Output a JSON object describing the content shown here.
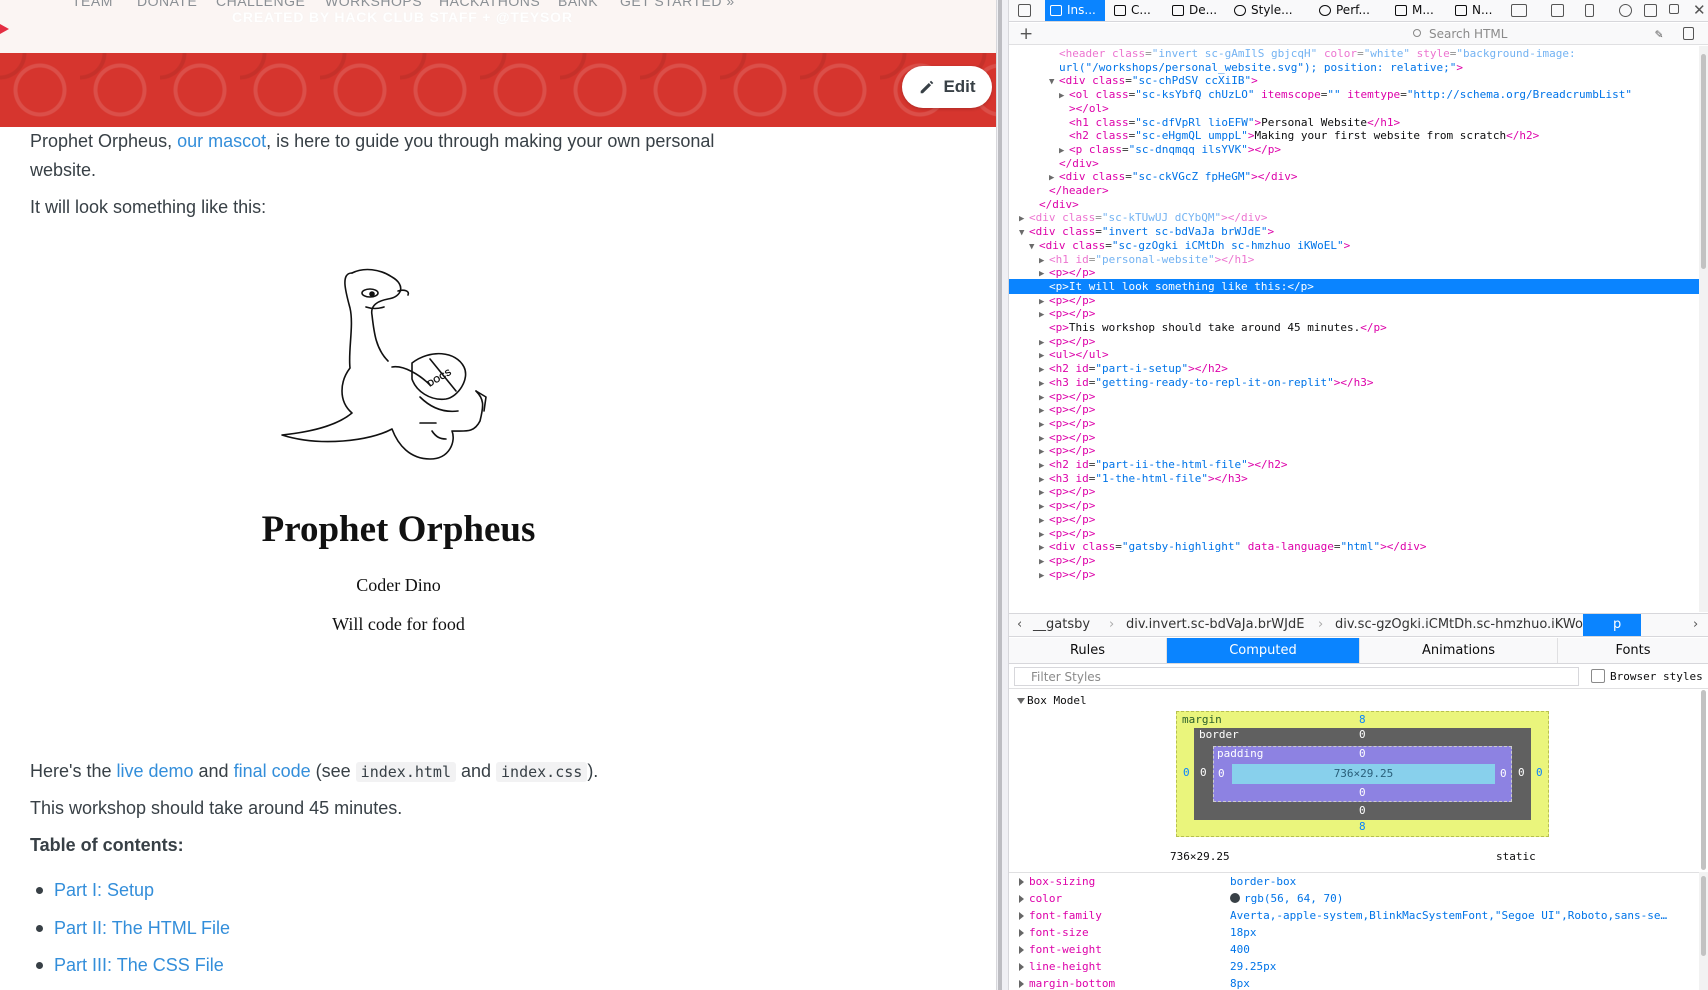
{
  "nav": {
    "items": [
      "TEAM",
      "DONATE",
      "CHALLENGE",
      "WORKSHOPS",
      "HACKATHONS",
      "BANK",
      "GET STARTED »"
    ],
    "ghost_text": "CREATED BY HACK CLUB STAFF + @TEYSOR"
  },
  "edit_button": "Edit",
  "intro": {
    "p1_before": "Prophet Orpheus, ",
    "p1_link": "our mascot",
    "p1_after": ", is here to guide you through making your own personal website.",
    "p2": "It will look something like this:"
  },
  "mascot": {
    "title": "Prophet Orpheus",
    "subtitle1": "Coder Dino",
    "subtitle2": "Will code for food",
    "book_text": "DOCS"
  },
  "lower": {
    "demo_prefix": "Here's the ",
    "demo_link": "live demo",
    "demo_and": " and ",
    "code_link": "final code",
    "demo_see": " (see ",
    "code1": "index.html",
    "demo_and2": " and ",
    "code2": "index.css",
    "demo_end": ").",
    "duration": "This workshop should take around 45 minutes.",
    "toc_title": "Table of contents:",
    "toc": [
      "Part I: Setup",
      "Part II: The HTML File",
      "Part III: The CSS File"
    ]
  },
  "devtools": {
    "tabs": [
      "Ins...",
      "C...",
      "De...",
      "Style...",
      "Perf...",
      "M...",
      "N..."
    ],
    "search_placeholder": "Search HTML",
    "breadcrumbs": [
      "__gatsby",
      "div.invert.sc-bdVaJa.brWJdE",
      "div.sc-gzOgki.iCMtDh.sc-hmzhuo.iKWoEL",
      "p"
    ],
    "side_tabs": [
      "Rules",
      "Computed",
      "Animations",
      "Fonts"
    ],
    "filter_placeholder": "Filter Styles",
    "browser_styles": "Browser styles",
    "box_model_title": "Box Model",
    "box_model": {
      "margin_label": "margin",
      "margin_top": "8",
      "margin_bottom": "8",
      "margin_left": "0",
      "margin_right": "0",
      "border_label": "border",
      "border_top": "0",
      "border_bottom": "0",
      "border_left": "0",
      "border_right": "0",
      "padding_label": "padding",
      "padding_top": "0",
      "padding_bottom": "0",
      "padding_left": "0",
      "padding_right": "0",
      "content": "736×29.25",
      "size": "736×29.25",
      "position": "static"
    },
    "properties": [
      {
        "name": "box-sizing",
        "value": "border-box"
      },
      {
        "name": "color",
        "value": "rgb(56, 64, 70)"
      },
      {
        "name": "font-family",
        "value": "Averta,-apple-system,BlinkMacSystemFont,\"Segoe UI\",Roboto,sans-se…"
      },
      {
        "name": "font-size",
        "value": "18px"
      },
      {
        "name": "font-weight",
        "value": "400"
      },
      {
        "name": "line-height",
        "value": "29.25px"
      },
      {
        "name": "margin-bottom",
        "value": "8px"
      }
    ],
    "markup": [
      {
        "indent": 5,
        "tw": "",
        "html": "<span class='dim'><span class='tag'>&lt;header</span> <span class='aname'>class</span>=<span class='val'>\"invert sc-gAmIlS gbjcqH\"</span> <span class='aname'>color</span>=<span class='val'>\"white\"</span> <span class='aname'>style</span>=<span class='val'>\"background-image:</span></span>"
      },
      {
        "indent": 5,
        "tw": "",
        "html": "<span class='val'>url(\"/workshops/personal_website.svg\"); position: relative;\"</span><span class='tag'>&gt;</span>"
      },
      {
        "indent": 5,
        "tw": "▼",
        "html": "<span class='tag'>&lt;div</span> <span class='aname'>class</span>=<span class='val'>\"sc-chPdSV ccXiIB\"</span><span class='tag'>&gt;</span>"
      },
      {
        "indent": 6,
        "tw": "▶",
        "html": "<span class='tag'>&lt;ol</span> <span class='aname'>class</span>=<span class='val'>\"sc-ksYbfQ chUzLO\"</span> <span class='aname'>itemscope</span>=<span class='val'>\"\"</span> <span class='aname'>itemtype</span>=<span class='val'>\"http://schema.org/BreadcrumbList\"</span>"
      },
      {
        "indent": 6,
        "tw": "",
        "html": "<span class='tag'>&gt;&lt;/ol&gt;</span>"
      },
      {
        "indent": 6,
        "tw": "",
        "html": "<span class='tag'>&lt;h1</span> <span class='aname'>class</span>=<span class='val'>\"sc-dfVpRl lioEFW\"</span><span class='tag'>&gt;</span><span class='txt'>Personal Website</span><span class='tag'>&lt;/h1&gt;</span>"
      },
      {
        "indent": 6,
        "tw": "",
        "html": "<span class='tag'>&lt;h2</span> <span class='aname'>class</span>=<span class='val'>\"sc-eHgmQL umppL\"</span><span class='tag'>&gt;</span><span class='txt'>Making your first website from scratch</span><span class='tag'>&lt;/h2&gt;</span>"
      },
      {
        "indent": 6,
        "tw": "▶",
        "html": "<span class='tag'>&lt;p</span> <span class='aname'>class</span>=<span class='val'>\"sc-dnqmqq ilsYVK\"</span><span class='tag'>&gt;&lt;/p&gt;</span>"
      },
      {
        "indent": 5,
        "tw": "",
        "html": "<span class='tag'>&lt;/div&gt;</span>"
      },
      {
        "indent": 5,
        "tw": "▶",
        "html": "<span class='tag'>&lt;div</span> <span class='aname'>class</span>=<span class='val'>\"sc-ckVGcZ fpHeGM\"</span><span class='tag'>&gt;&lt;/div&gt;</span>"
      },
      {
        "indent": 4,
        "tw": "",
        "html": "<span class='tag'>&lt;/header&gt;</span>"
      },
      {
        "indent": 3,
        "tw": "",
        "html": "<span class='tag'>&lt;/div&gt;</span>"
      },
      {
        "indent": 2,
        "tw": "▶",
        "html": "<span class='dim'><span class='tag'>&lt;div</span> <span class='aname'>class</span>=<span class='val'>\"sc-kTUwUJ dCYbQM\"</span><span class='tag'>&gt;&lt;/div&gt;</span></span>"
      },
      {
        "indent": 2,
        "tw": "▼",
        "html": "<span class='tag'>&lt;div</span> <span class='aname'>class</span>=<span class='val'>\"invert sc-bdVaJa brWJdE\"</span><span class='tag'>&gt;</span>"
      },
      {
        "indent": 3,
        "tw": "▼",
        "html": "<span class='tag'>&lt;div</span> <span class='aname'>class</span>=<span class='val'>\"sc-gzOgki iCMtDh sc-hmzhuo iKWoEL\"</span><span class='tag'>&gt;</span>"
      },
      {
        "indent": 4,
        "tw": "▶",
        "html": "<span class='dim'><span class='tag'>&lt;h1</span> <span class='aname'>id</span>=<span class='val'>\"personal-website\"</span><span class='tag'>&gt;&lt;/h1&gt;</span></span>"
      },
      {
        "indent": 4,
        "tw": "▶",
        "html": "<span class='tag'>&lt;p&gt;&lt;/p&gt;</span>"
      },
      {
        "indent": 4,
        "tw": "",
        "sel": true,
        "html": "<span class='tag'>&lt;p&gt;</span><span class='txt'>It will look something like this:</span><span class='tag'>&lt;/p&gt;</span>"
      },
      {
        "indent": 4,
        "tw": "▶",
        "html": "<span class='tag'>&lt;p&gt;&lt;/p&gt;</span>"
      },
      {
        "indent": 4,
        "tw": "▶",
        "html": "<span class='tag'>&lt;p&gt;&lt;/p&gt;</span>"
      },
      {
        "indent": 4,
        "tw": "",
        "html": "<span class='tag'>&lt;p&gt;</span><span class='txt'>This workshop should take around 45 minutes.</span><span class='tag'>&lt;/p&gt;</span>"
      },
      {
        "indent": 4,
        "tw": "▶",
        "html": "<span class='tag'>&lt;p&gt;&lt;/p&gt;</span>"
      },
      {
        "indent": 4,
        "tw": "▶",
        "html": "<span class='tag'>&lt;ul&gt;&lt;/ul&gt;</span>"
      },
      {
        "indent": 4,
        "tw": "▶",
        "html": "<span class='tag'>&lt;h2</span> <span class='aname'>id</span>=<span class='val'>\"part-i-setup\"</span><span class='tag'>&gt;&lt;/h2&gt;</span>"
      },
      {
        "indent": 4,
        "tw": "▶",
        "html": "<span class='tag'>&lt;h3</span> <span class='aname'>id</span>=<span class='val'>\"getting-ready-to-repl-it-on-replit\"</span><span class='tag'>&gt;&lt;/h3&gt;</span>"
      },
      {
        "indent": 4,
        "tw": "▶",
        "html": "<span class='tag'>&lt;p&gt;&lt;/p&gt;</span>"
      },
      {
        "indent": 4,
        "tw": "▶",
        "html": "<span class='tag'>&lt;p&gt;&lt;/p&gt;</span>"
      },
      {
        "indent": 4,
        "tw": "▶",
        "html": "<span class='tag'>&lt;p&gt;&lt;/p&gt;</span>"
      },
      {
        "indent": 4,
        "tw": "▶",
        "html": "<span class='tag'>&lt;p&gt;&lt;/p&gt;</span>"
      },
      {
        "indent": 4,
        "tw": "▶",
        "html": "<span class='tag'>&lt;p&gt;&lt;/p&gt;</span>"
      },
      {
        "indent": 4,
        "tw": "▶",
        "html": "<span class='tag'>&lt;h2</span> <span class='aname'>id</span>=<span class='val'>\"part-ii-the-html-file\"</span><span class='tag'>&gt;&lt;/h2&gt;</span>"
      },
      {
        "indent": 4,
        "tw": "▶",
        "html": "<span class='tag'>&lt;h3</span> <span class='aname'>id</span>=<span class='val'>\"1-the-html-file\"</span><span class='tag'>&gt;&lt;/h3&gt;</span>"
      },
      {
        "indent": 4,
        "tw": "▶",
        "html": "<span class='tag'>&lt;p&gt;&lt;/p&gt;</span>"
      },
      {
        "indent": 4,
        "tw": "▶",
        "html": "<span class='tag'>&lt;p&gt;&lt;/p&gt;</span>"
      },
      {
        "indent": 4,
        "tw": "▶",
        "html": "<span class='tag'>&lt;p&gt;&lt;/p&gt;</span>"
      },
      {
        "indent": 4,
        "tw": "▶",
        "html": "<span class='tag'>&lt;p&gt;&lt;/p&gt;</span>"
      },
      {
        "indent": 4,
        "tw": "▶",
        "html": "<span class='tag'>&lt;div</span> <span class='aname'>class</span>=<span class='val'>\"gatsby-highlight\"</span> <span class='aname'>data-language</span>=<span class='val'>\"html\"</span><span class='tag'>&gt;&lt;/div&gt;</span>"
      },
      {
        "indent": 4,
        "tw": "▶",
        "html": "<span class='tag'>&lt;p&gt;&lt;/p&gt;</span>"
      },
      {
        "indent": 4,
        "tw": "▶",
        "html": "<span class='tag'>&lt;p&gt;&lt;/p&gt;</span>"
      }
    ]
  }
}
